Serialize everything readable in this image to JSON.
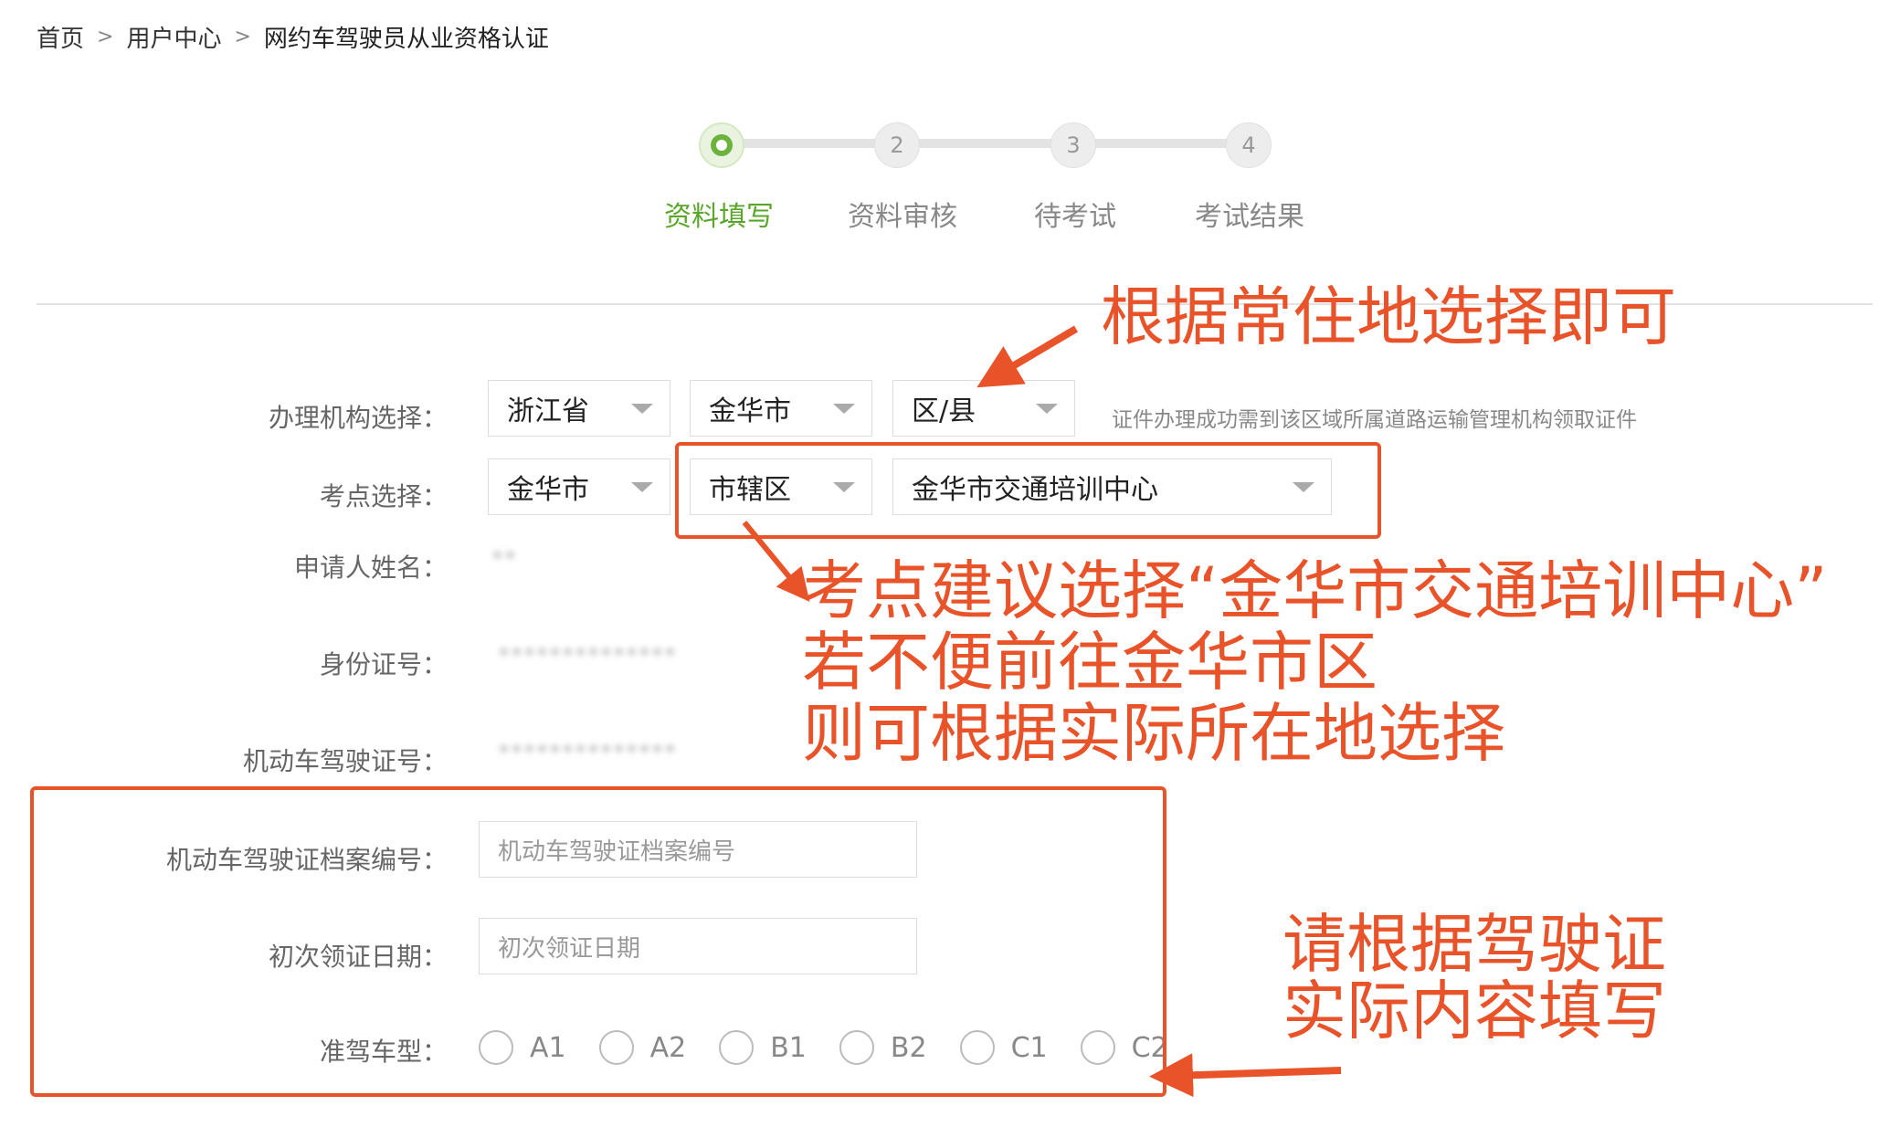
{
  "breadcrumb": {
    "home": "首页",
    "user_center": "用户中心",
    "current": "网约车驾驶员从业资格认证",
    "separator": ">"
  },
  "stepper": {
    "steps": [
      {
        "number": "1",
        "label": "资料填写",
        "active": true
      },
      {
        "number": "2",
        "label": "资料审核",
        "active": false
      },
      {
        "number": "3",
        "label": "待考试",
        "active": false
      },
      {
        "number": "4",
        "label": "考试结果",
        "active": false
      }
    ],
    "colors": {
      "active": "#5aa62b",
      "inactive": "#888888"
    }
  },
  "form": {
    "agency": {
      "label": "办理机构选择：",
      "province": "浙江省",
      "city": "金华市",
      "district": "区/县",
      "hint": "证件办理成功需到该区域所属道路运输管理机构领取证件"
    },
    "exam_site": {
      "label": "考点选择：",
      "city": "金华市",
      "district": "市辖区",
      "site": "金华市交通培训中心"
    },
    "applicant_name": {
      "label": "申请人姓名：",
      "value": "**"
    },
    "id_number": {
      "label": "身份证号：",
      "value": "**************"
    },
    "license_number": {
      "label": "机动车驾驶证号：",
      "value": "**************"
    },
    "archive_number": {
      "label": "机动车驾驶证档案编号：",
      "placeholder": "机动车驾驶证档案编号"
    },
    "first_issue_date": {
      "label": "初次领证日期：",
      "placeholder": "初次领证日期"
    },
    "vehicle_class": {
      "label": "准驾车型：",
      "options": [
        "A1",
        "A2",
        "B1",
        "B2",
        "C1",
        "C2"
      ]
    }
  },
  "annotations": {
    "top_note": "根据常住地选择即可",
    "exam_note_1": "考点建议选择“金华市交通培训中心”",
    "exam_note_2": "若不便前往金华市区",
    "exam_note_3": "则可根据实际所在地选择",
    "license_note_1": "请根据驾驶证",
    "license_note_2": "实际内容填写",
    "color": "#e8532a"
  }
}
